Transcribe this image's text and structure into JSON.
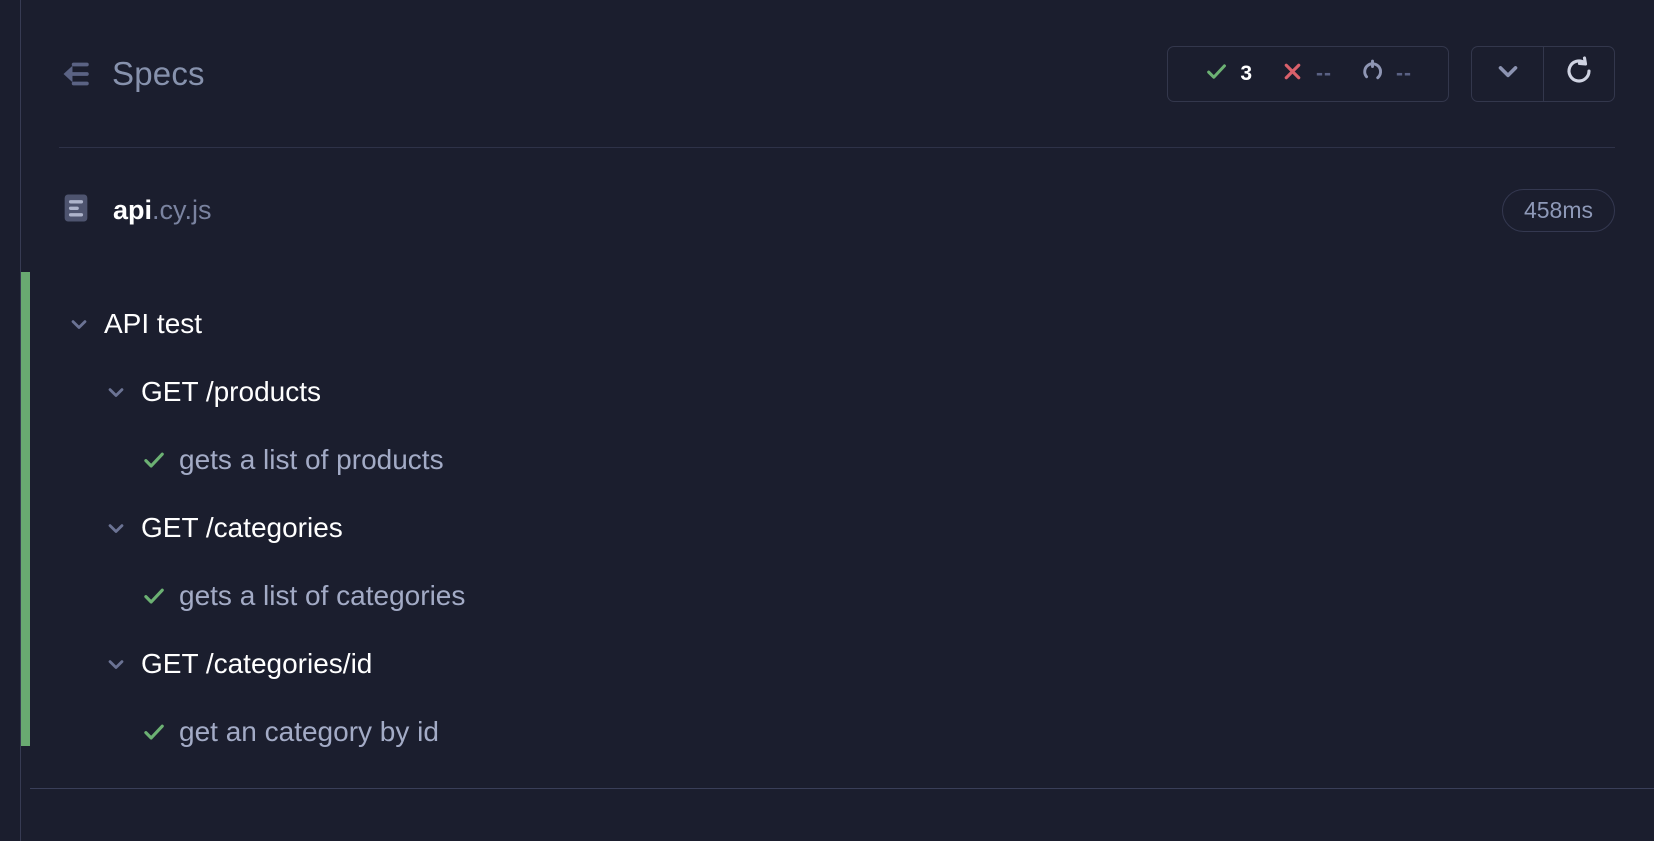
{
  "header": {
    "back_icon": "back-arrow-lines-icon",
    "title": "Specs",
    "stats": [
      {
        "icon": "check-icon",
        "name": "passed",
        "value": "3"
      },
      {
        "icon": "cross-icon",
        "name": "failed",
        "value": "--"
      },
      {
        "icon": "loop-icon",
        "name": "pending",
        "value": "--"
      }
    ],
    "buttons": [
      {
        "icon": "chevron-down-icon",
        "name": "collapse-all-button"
      },
      {
        "icon": "refresh-icon",
        "name": "rerun-button"
      }
    ]
  },
  "spec": {
    "file_icon": "file-document-icon",
    "base_name": "api",
    "extension": ".cy.js",
    "duration": "458ms"
  },
  "tests": [
    {
      "level": 1,
      "kind": "suite",
      "label": "API test"
    },
    {
      "level": 2,
      "kind": "suite",
      "label": "GET /products"
    },
    {
      "level": 3,
      "kind": "test",
      "label": "gets a list of products",
      "status": "passed"
    },
    {
      "level": 2,
      "kind": "suite",
      "label": "GET /categories"
    },
    {
      "level": 3,
      "kind": "test",
      "label": "gets a list of categories",
      "status": "passed"
    },
    {
      "level": 2,
      "kind": "suite",
      "label": "GET /categories/id"
    },
    {
      "level": 3,
      "kind": "test",
      "label": "get an category by id",
      "status": "passed"
    }
  ],
  "colors": {
    "background": "#1b1e2e",
    "pass_green": "#69a971",
    "fail_red": "#d9606b",
    "muted": "#5a6184",
    "border": "#33374c"
  }
}
